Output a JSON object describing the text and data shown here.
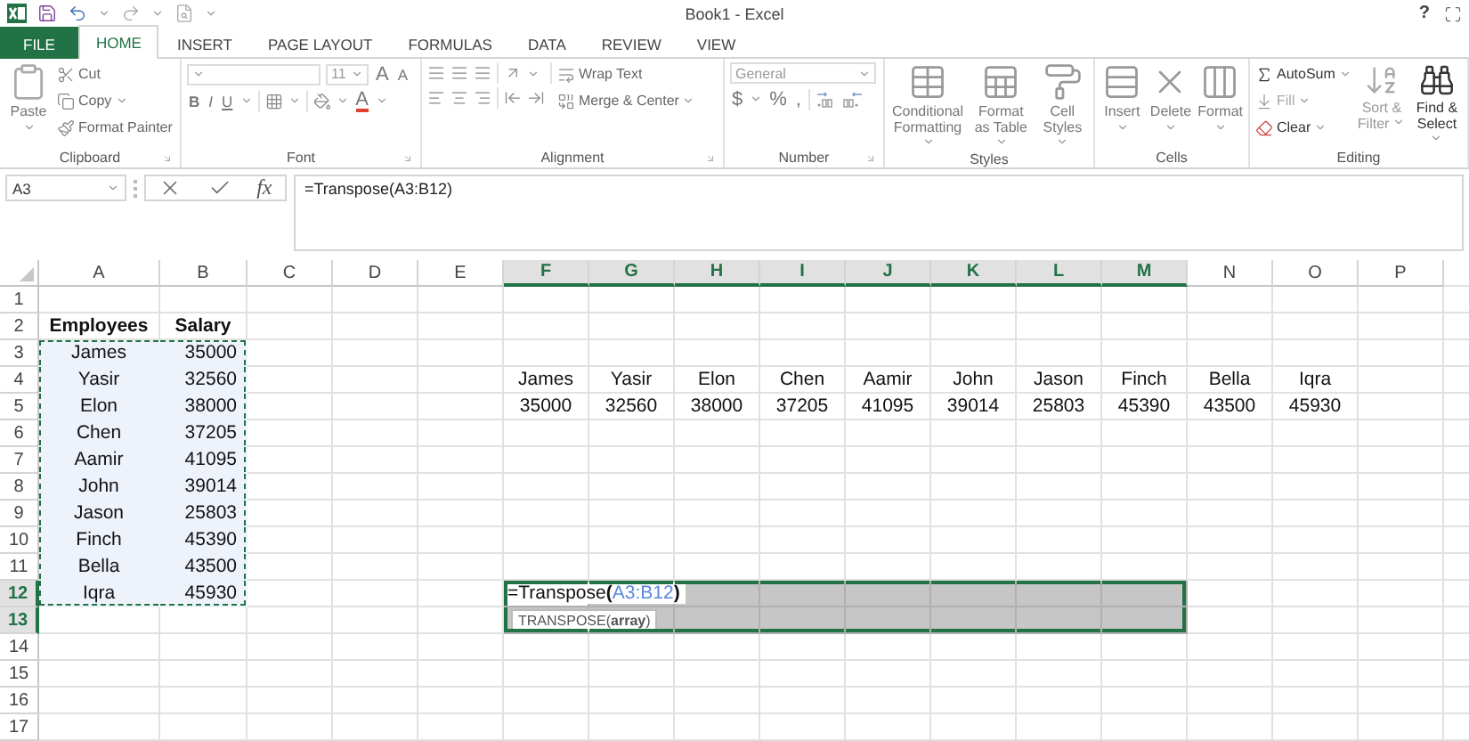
{
  "window": {
    "title": "Book1 - Excel",
    "help": "?"
  },
  "ribbon_tabs": [
    {
      "label": "FILE",
      "kind": "file",
      "selected": false
    },
    {
      "label": "HOME",
      "kind": "tab",
      "selected": true
    },
    {
      "label": "INSERT",
      "kind": "tab",
      "selected": false
    },
    {
      "label": "PAGE LAYOUT",
      "kind": "tab",
      "selected": false
    },
    {
      "label": "FORMULAS",
      "kind": "tab",
      "selected": false
    },
    {
      "label": "DATA",
      "kind": "tab",
      "selected": false
    },
    {
      "label": "REVIEW",
      "kind": "tab",
      "selected": false
    },
    {
      "label": "VIEW",
      "kind": "tab",
      "selected": false
    }
  ],
  "ribbon_groups": [
    {
      "kind": "clipboard",
      "name": "Clipboard",
      "paste": "Paste",
      "commands": [
        "Cut",
        "Copy",
        "Format Painter"
      ]
    },
    {
      "kind": "font",
      "name": "Font",
      "size": "11",
      "grow": "A",
      "shrink": "A",
      "styles": [
        "B",
        "I",
        "U"
      ],
      "font_color": "A"
    },
    {
      "kind": "alignment",
      "name": "Alignment",
      "commands": [
        "Wrap Text",
        "Merge & Center"
      ]
    },
    {
      "kind": "number",
      "name": "Number",
      "format": "General",
      "symbols": [
        "$",
        "%",
        ","
      ]
    },
    {
      "kind": "styles",
      "name": "Styles",
      "commands": [
        "Conditional Formatting",
        "Format as Table",
        "Cell Styles"
      ]
    },
    {
      "kind": "cells",
      "name": "Cells",
      "commands": [
        "Insert",
        "Delete",
        "Format"
      ]
    },
    {
      "kind": "editing",
      "name": "Editing",
      "commands": [
        "AutoSum",
        "Fill",
        "Clear"
      ],
      "big_commands": [
        "Sort & Filter",
        "Find & Select"
      ]
    }
  ],
  "formula_bar": {
    "name_box": "A3",
    "function_label": "fx",
    "formula": "=Transpose(A3:B12)"
  },
  "sheet": {
    "columns": [
      {
        "label": "A",
        "selected": false
      },
      {
        "label": "B",
        "selected": false
      },
      {
        "label": "C",
        "selected": false
      },
      {
        "label": "D",
        "selected": false
      },
      {
        "label": "E",
        "selected": false
      },
      {
        "label": "F",
        "selected": true
      },
      {
        "label": "G",
        "selected": true
      },
      {
        "label": "H",
        "selected": true
      },
      {
        "label": "I",
        "selected": true
      },
      {
        "label": "J",
        "selected": true
      },
      {
        "label": "K",
        "selected": true
      },
      {
        "label": "L",
        "selected": true
      },
      {
        "label": "M",
        "selected": true
      },
      {
        "label": "N",
        "selected": false
      },
      {
        "label": "O",
        "selected": false
      },
      {
        "label": "P",
        "selected": false
      }
    ],
    "rows": [
      {
        "label": "1",
        "selected": false,
        "cells": [
          null,
          null,
          null,
          null,
          null,
          null,
          null,
          null,
          null,
          null,
          null,
          null,
          null,
          null,
          null,
          null
        ]
      },
      {
        "label": "2",
        "selected": false,
        "cells": [
          {
            "text": "Employees",
            "bold": true
          },
          {
            "text": "Salary",
            "bold": true
          },
          null,
          null,
          null,
          null,
          null,
          null,
          null,
          null,
          null,
          null,
          null,
          null,
          null,
          null
        ]
      },
      {
        "label": "3",
        "selected": false,
        "cells": [
          {
            "text": "James",
            "copied": true
          },
          {
            "text": "35000",
            "right_aligned": true,
            "copied": true
          },
          null,
          null,
          null,
          null,
          null,
          null,
          null,
          null,
          null,
          null,
          null,
          null,
          null,
          null
        ]
      },
      {
        "label": "4",
        "selected": false,
        "cells": [
          {
            "text": "Yasir",
            "copied": true
          },
          {
            "text": "32560",
            "right_aligned": true,
            "copied": true
          },
          null,
          null,
          null,
          {
            "text": "James"
          },
          {
            "text": "Yasir"
          },
          {
            "text": "Elon"
          },
          {
            "text": "Chen"
          },
          {
            "text": "Aamir"
          },
          {
            "text": "John"
          },
          {
            "text": "Jason"
          },
          {
            "text": "Finch"
          },
          {
            "text": "Bella"
          },
          {
            "text": "Iqra"
          },
          null
        ]
      },
      {
        "label": "5",
        "selected": false,
        "cells": [
          {
            "text": "Elon",
            "copied": true
          },
          {
            "text": "38000",
            "right_aligned": true,
            "copied": true
          },
          null,
          null,
          null,
          {
            "text": "35000"
          },
          {
            "text": "32560"
          },
          {
            "text": "38000"
          },
          {
            "text": "37205"
          },
          {
            "text": "41095"
          },
          {
            "text": "39014"
          },
          {
            "text": "25803"
          },
          {
            "text": "45390"
          },
          {
            "text": "43500"
          },
          {
            "text": "45930"
          },
          null
        ]
      },
      {
        "label": "6",
        "selected": false,
        "cells": [
          {
            "text": "Chen",
            "copied": true
          },
          {
            "text": "37205",
            "right_aligned": true,
            "copied": true
          },
          null,
          null,
          null,
          null,
          null,
          null,
          null,
          null,
          null,
          null,
          null,
          null,
          null,
          null
        ]
      },
      {
        "label": "7",
        "selected": false,
        "cells": [
          {
            "text": "Aamir",
            "copied": true
          },
          {
            "text": "41095",
            "right_aligned": true,
            "copied": true
          },
          null,
          null,
          null,
          null,
          null,
          null,
          null,
          null,
          null,
          null,
          null,
          null,
          null,
          null
        ]
      },
      {
        "label": "8",
        "selected": false,
        "cells": [
          {
            "text": "John",
            "copied": true
          },
          {
            "text": "39014",
            "right_aligned": true,
            "copied": true
          },
          null,
          null,
          null,
          null,
          null,
          null,
          null,
          null,
          null,
          null,
          null,
          null,
          null,
          null
        ]
      },
      {
        "label": "9",
        "selected": false,
        "cells": [
          {
            "text": "Jason",
            "copied": true
          },
          {
            "text": "25803",
            "right_aligned": true,
            "copied": true
          },
          null,
          null,
          null,
          null,
          null,
          null,
          null,
          null,
          null,
          null,
          null,
          null,
          null,
          null
        ]
      },
      {
        "label": "10",
        "selected": false,
        "cells": [
          {
            "text": "Finch",
            "copied": true
          },
          {
            "text": "45390",
            "right_aligned": true,
            "copied": true
          },
          null,
          null,
          null,
          null,
          null,
          null,
          null,
          null,
          null,
          null,
          null,
          null,
          null,
          null
        ]
      },
      {
        "label": "11",
        "selected": false,
        "cells": [
          {
            "text": "Bella",
            "copied": true
          },
          {
            "text": "43500",
            "right_aligned": true,
            "copied": true
          },
          null,
          null,
          null,
          null,
          null,
          null,
          null,
          null,
          null,
          null,
          null,
          null,
          null,
          null
        ]
      },
      {
        "label": "12",
        "selected": true,
        "cells": [
          {
            "text": "Iqra",
            "copied": true
          },
          {
            "text": "45930",
            "right_aligned": true,
            "copied": true
          },
          null,
          null,
          null,
          {
            "selected": true,
            "active": true,
            "editor": [
              {
                "kind": "plain",
                "text": "=Transpose"
              },
              {
                "kind": "paren",
                "text": "("
              },
              {
                "kind": "reference",
                "text": "A3:B12"
              },
              {
                "kind": "paren",
                "text": ")"
              }
            ]
          },
          {
            "selected": true
          },
          {
            "selected": true
          },
          {
            "selected": true
          },
          {
            "selected": true
          },
          {
            "selected": true
          },
          {
            "selected": true
          },
          {
            "selected": true
          },
          null,
          null,
          null
        ]
      },
      {
        "label": "13",
        "selected": true,
        "cells": [
          null,
          null,
          null,
          null,
          null,
          {
            "selected": true,
            "tooltip": "TRANSPOSE(**array**)"
          },
          {
            "selected": true
          },
          {
            "selected": true
          },
          {
            "selected": true
          },
          {
            "selected": true
          },
          {
            "selected": true
          },
          {
            "selected": true
          },
          {
            "selected": true
          },
          null,
          null,
          null
        ]
      },
      {
        "label": "14",
        "selected": false,
        "cells": [
          null,
          null,
          null,
          null,
          null,
          null,
          null,
          null,
          null,
          null,
          null,
          null,
          null,
          null,
          null,
          null
        ]
      },
      {
        "label": "15",
        "selected": false,
        "cells": [
          null,
          null,
          null,
          null,
          null,
          null,
          null,
          null,
          null,
          null,
          null,
          null,
          null,
          null,
          null,
          null
        ]
      },
      {
        "label": "16",
        "selected": false,
        "cells": [
          null,
          null,
          null,
          null,
          null,
          null,
          null,
          null,
          null,
          null,
          null,
          null,
          null,
          null,
          null,
          null
        ]
      },
      {
        "label": "17",
        "selected": false,
        "cells": [
          null,
          null,
          null,
          null,
          null,
          null,
          null,
          null,
          null,
          null,
          null,
          null,
          null,
          null,
          null,
          null
        ]
      }
    ]
  }
}
